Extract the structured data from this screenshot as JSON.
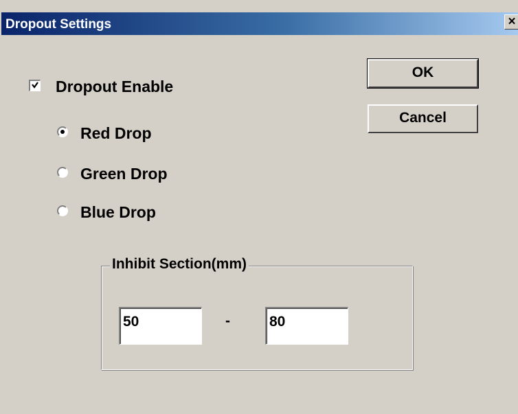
{
  "window": {
    "title": "Dropout Settings",
    "close_label": "×"
  },
  "dropout": {
    "enable_label": "Dropout Enable",
    "enabled": true,
    "options": [
      {
        "label": "Red Drop",
        "selected": true
      },
      {
        "label": "Green Drop",
        "selected": false
      },
      {
        "label": "Blue Drop",
        "selected": false
      }
    ]
  },
  "buttons": {
    "ok_label": "OK",
    "cancel_label": "Cancel"
  },
  "inhibit": {
    "legend": "Inhibit Section(mm)",
    "from_value": "50",
    "separator": "-",
    "to_value": "80"
  }
}
